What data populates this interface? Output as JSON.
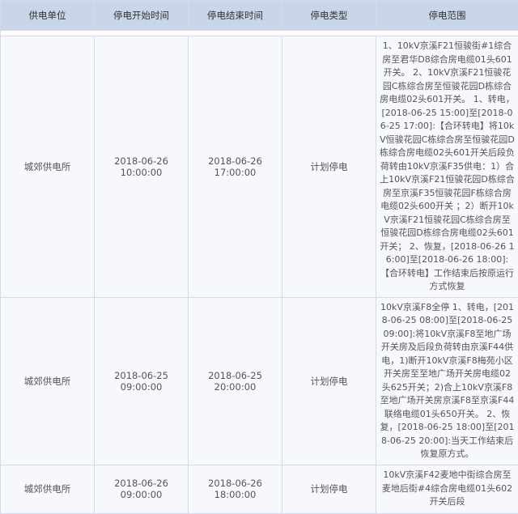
{
  "table": {
    "headers": [
      "供电单位",
      "停电开始时间",
      "停电结束时间",
      "停电类型",
      "停电范围"
    ],
    "rows": [
      {
        "unit": "城郊供电所",
        "start": "2018-06-26 10:00:00",
        "end": "2018-06-26 17:00:00",
        "type": "计划停电",
        "range": "1、10kV京溪F21恒骏街#1综合房至君华D8综合房电缆01头601开关。 2、10kV京溪F21恒骏花园C栋综合房至恒骏花园D栋综合房电缆02头601开关。 1、转电，[2018-06-25 15:00]至[2018-06-25 17:00]:【合环转电】将10kV恒骏花园C栋综合房至恒骏花园D栋综合房电缆02头601开关后段负荷转由10kV京溪F35供电：1）合上10kV京溪F21恒骏花园D栋综合房至京溪F35恒骏花园F栋综合房电缆02头600开关 ；2）断开10kV京溪F21恒骏花园C栋综合房至恒骏花园D栋综合房电缆02头601开关； 2、恢复，[2018-06-26 16:00]至[2018-06-26 18:00]:【合环转电】工作结束后按原运行方式恢复"
      },
      {
        "unit": "城郊供电所",
        "start": "2018-06-25 09:00:00",
        "end": "2018-06-25 20:00:00",
        "type": "计划停电",
        "range": "10kV京溪F8全停 1、转电，[2018-06-25 08:00]至[2018-06-25 09:00]:将10kV京溪F8至地广场开关房及后段负荷转由京溪F44供电，1)断开10kV京溪F8梅苑小区开关房至至地广场开关房电缆02头625开关；2)合上10kV京溪F8至地广场开关房京溪F8至京溪F44联络电缆01头650开关。 2、恢复，[2018-06-25 18:00]至[2018-06-25 20:00]:当天工作结束后恢复原方式。"
      },
      {
        "unit": "城郊供电所",
        "start": "2018-06-26 09:00:00",
        "end": "2018-06-26 18:00:00",
        "type": "计划停电",
        "range": "10kV京溪F42麦地中街综合房至麦地后街#4综合房电缆01头602开关后段"
      }
    ]
  }
}
